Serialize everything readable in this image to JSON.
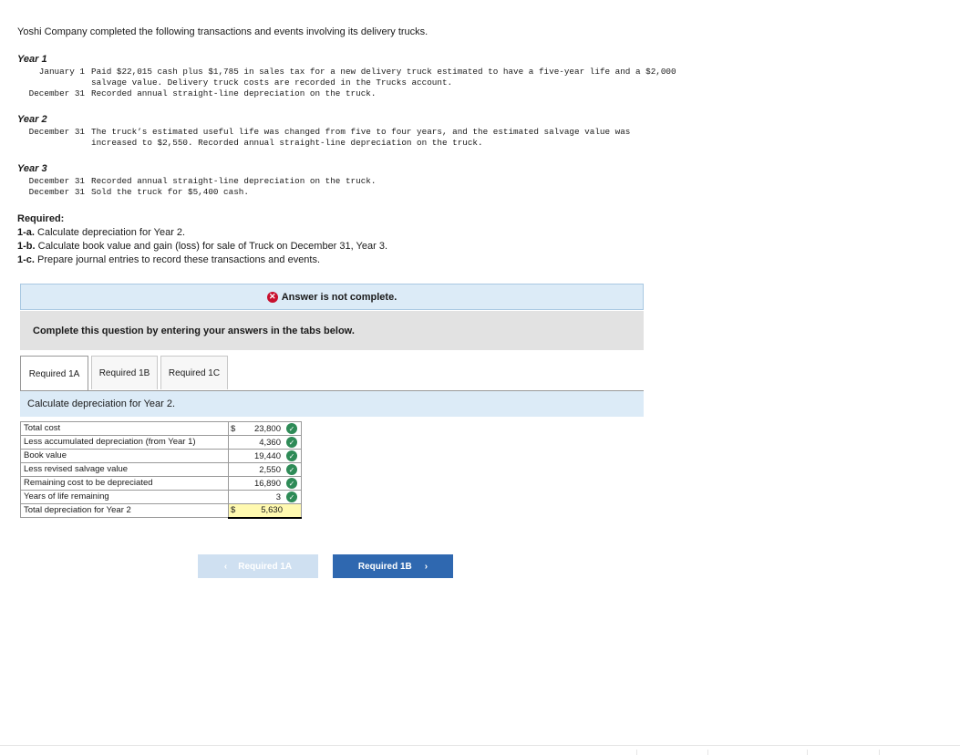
{
  "intro": "Yoshi Company completed the following transactions and events involving its delivery trucks.",
  "years": [
    {
      "label": "Year 1",
      "entries": [
        {
          "date": "January 1",
          "text": "Paid $22,015 cash plus $1,785 in sales tax for a new delivery truck estimated to have a five-year life and a $2,000 salvage value. Delivery truck costs are recorded in the Trucks account."
        },
        {
          "date": "December 31",
          "text": "Recorded annual straight-line depreciation on the truck."
        }
      ]
    },
    {
      "label": "Year 2",
      "entries": [
        {
          "date": "December 31",
          "text": "The truck’s estimated useful life was changed from five to four years, and the estimated salvage value was increased to $2,550. Recorded annual straight-line depreciation on the truck."
        }
      ]
    },
    {
      "label": "Year 3",
      "entries": [
        {
          "date": "December 31",
          "text": "Recorded annual straight-line depreciation on the truck."
        },
        {
          "date": "December 31",
          "text": "Sold the truck for $5,400 cash."
        }
      ]
    }
  ],
  "required": {
    "heading": "Required:",
    "items": [
      {
        "label": "1-a.",
        "text": "Calculate depreciation for Year 2."
      },
      {
        "label": "1-b.",
        "text": "Calculate book value and gain (loss) for sale of Truck on December 31, Year 3."
      },
      {
        "label": "1-c.",
        "text": "Prepare journal entries to record these transactions and events."
      }
    ]
  },
  "alert": {
    "text": "Answer is not complete.",
    "icon": "error-x-icon",
    "color": "#c8102e"
  },
  "instruction": "Complete this question by entering your answers in the tabs below.",
  "tabs": [
    {
      "label": "Required 1A",
      "active": true
    },
    {
      "label": "Required 1B",
      "active": false
    },
    {
      "label": "Required 1C",
      "active": false
    }
  ],
  "panel_title": "Calculate depreciation for Year 2.",
  "table": [
    {
      "label": "Total cost",
      "currency": "$",
      "value": "23,800",
      "check": true
    },
    {
      "label": "Less accumulated depreciation (from Year 1)",
      "currency": "",
      "value": "4,360",
      "check": true
    },
    {
      "label": "Book value",
      "currency": "",
      "value": "19,440",
      "check": true
    },
    {
      "label": "Less revised salvage value",
      "currency": "",
      "value": "2,550",
      "check": true
    },
    {
      "label": "Remaining cost to be depreciated",
      "currency": "",
      "value": "16,890",
      "check": true
    },
    {
      "label": "Years of life remaining",
      "currency": "",
      "value": "3",
      "check": true
    },
    {
      "label": "Total depreciation for Year 2",
      "currency": "$",
      "value": "5,630",
      "check": false
    }
  ],
  "nav": {
    "prev": "Required 1A",
    "next": "Required 1B"
  },
  "colors": {
    "accent": "#2f68b0",
    "check": "#2e8b57",
    "highlight": "#fff9b0"
  }
}
